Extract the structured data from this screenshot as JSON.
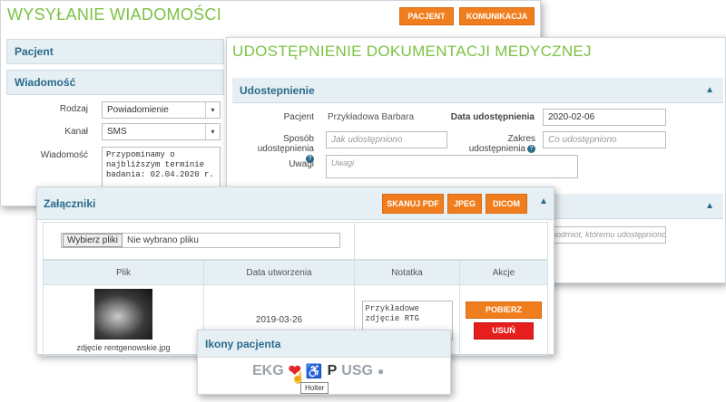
{
  "send": {
    "title": "WYSYŁANIE WIADOMOŚCI",
    "buttons": {
      "patient": "PACJENT",
      "message": "KOMUNIKACJA"
    },
    "patient_section": "Pacjent",
    "message_section": "Wiadomość",
    "type_label": "Rodzaj",
    "type_value": "Powiadomienie",
    "channel_label": "Kanał",
    "channel_value": "SMS",
    "message_label": "Wiadomość",
    "message_value": "Przypominamy o najbliższym terminie badania: 02.04.2020 r."
  },
  "share": {
    "title": "UDOSTĘPNIENIE DOKUMENTACJI MEDYCZNEJ",
    "section": "Udostepnienie",
    "patient_label": "Pacjent",
    "patient_value": "Przykładowa Barbara",
    "date_label": "Data udostępnienia",
    "date_value": "2020-02-06",
    "method_label_1": "Sposób",
    "method_label_2": "udostępnienia",
    "method_placeholder": "Jak udostępniono",
    "scope_label_1": "Zakres",
    "scope_label_2": "udostępnienia",
    "scope_placeholder": "Co udostępniono",
    "notes_label": "Uwagi",
    "notes_placeholder": "Uwagi",
    "recipient_placeholder": "podmiot, któremu udostępniono c"
  },
  "attachments": {
    "title": "Załączniki",
    "buttons": {
      "scan": "SKANUJ PDF",
      "jpeg": "JPEG",
      "dicom": "DICOM"
    },
    "file_button": "Wybierz pliki",
    "file_status": "Nie wybrano pliku",
    "columns": [
      "Plik",
      "Data utworzenia",
      "Notatka",
      "Akcje"
    ],
    "row": {
      "file_name": "zdjęcie rentgenowskie.jpg",
      "date": "2019-03-26",
      "note": "Przykładowe zdjęcie RTG",
      "download": "POBIERZ",
      "delete": "USUŃ"
    }
  },
  "icons_panel": {
    "title": "Ikony pacjenta",
    "ekg": "EKG",
    "p": "P",
    "usg": "USG",
    "tooltip": "Holter",
    "icons": [
      "heart-icon",
      "wheelchair-icon",
      "globe-icon",
      "hand-cursor-icon"
    ],
    "colors": {
      "heart": "#e5262b",
      "muted": "#9aa3aa"
    }
  },
  "colors": {
    "accent_orange": "#f07e1e",
    "title_green": "#7cc242",
    "section_blue": "#2a6c8c",
    "delete_red": "#e61e1e"
  }
}
